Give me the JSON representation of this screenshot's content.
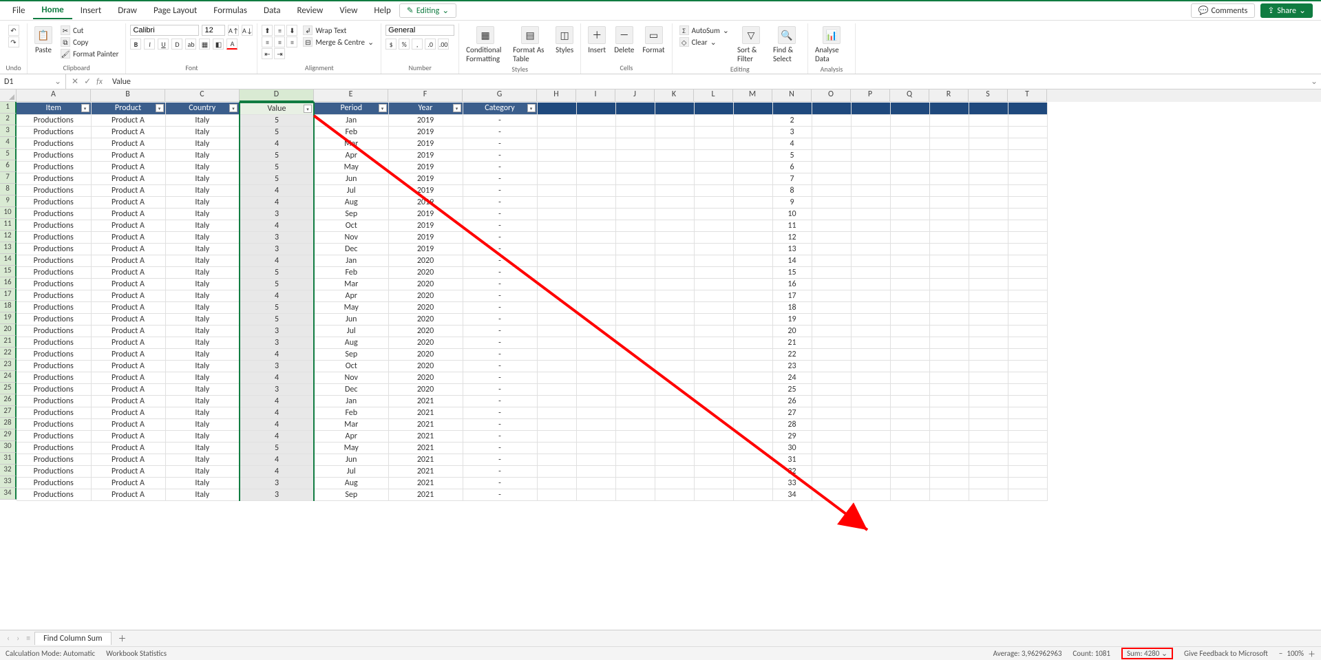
{
  "tabs": {
    "file": "File",
    "home": "Home",
    "insert": "Insert",
    "draw": "Draw",
    "layout": "Page Layout",
    "formulas": "Formulas",
    "data": "Data",
    "review": "Review",
    "view": "View",
    "help": "Help",
    "editing": "Editing",
    "comments": "Comments",
    "share": "Share"
  },
  "ribbon": {
    "undo": "Undo",
    "paste": "Paste",
    "cut": "Cut",
    "copy": "Copy",
    "painter": "Format Painter",
    "clipboard": "Clipboard",
    "font": "Font",
    "font_name": "Calibri",
    "font_size": "12",
    "alignment": "Alignment",
    "wrap": "Wrap Text",
    "merge": "Merge & Centre",
    "number": "Number",
    "number_format": "General",
    "styles": "Styles",
    "cond_fmt": "Conditional Formatting",
    "fmt_table": "Format As Table",
    "cell_styles": "Styles",
    "cells": "Cells",
    "insert_c": "Insert",
    "delete_c": "Delete",
    "format_c": "Format",
    "editing_g": "Editing",
    "autosum": "AutoSum",
    "clear": "Clear",
    "sort_filter": "Sort & Filter",
    "find_select": "Find & Select",
    "analysis": "Analysis",
    "analyse": "Analyse Data"
  },
  "formula": {
    "cell": "D1",
    "value": "Value"
  },
  "cols": [
    "A",
    "B",
    "C",
    "D",
    "E",
    "F",
    "G",
    "H",
    "I",
    "J",
    "K",
    "L",
    "M",
    "N",
    "O",
    "P",
    "Q",
    "R",
    "S",
    "T"
  ],
  "headers": [
    "Item",
    "Product",
    "Country",
    "Value",
    "Period",
    "Year",
    "Category"
  ],
  "rows": [
    {
      "n": 1
    },
    {
      "n": 2,
      "a": "Productions",
      "b": "Product A",
      "c": "Italy",
      "d": "5",
      "e": "Jan",
      "f": "2019",
      "g": "-"
    },
    {
      "n": 3,
      "a": "Productions",
      "b": "Product A",
      "c": "Italy",
      "d": "5",
      "e": "Feb",
      "f": "2019",
      "g": "-"
    },
    {
      "n": 4,
      "a": "Productions",
      "b": "Product A",
      "c": "Italy",
      "d": "4",
      "e": "Mar",
      "f": "2019",
      "g": "-"
    },
    {
      "n": 5,
      "a": "Productions",
      "b": "Product A",
      "c": "Italy",
      "d": "5",
      "e": "Apr",
      "f": "2019",
      "g": "-"
    },
    {
      "n": 6,
      "a": "Productions",
      "b": "Product A",
      "c": "Italy",
      "d": "5",
      "e": "May",
      "f": "2019",
      "g": "-"
    },
    {
      "n": 7,
      "a": "Productions",
      "b": "Product A",
      "c": "Italy",
      "d": "5",
      "e": "Jun",
      "f": "2019",
      "g": "-"
    },
    {
      "n": 8,
      "a": "Productions",
      "b": "Product A",
      "c": "Italy",
      "d": "4",
      "e": "Jul",
      "f": "2019",
      "g": "-"
    },
    {
      "n": 9,
      "a": "Productions",
      "b": "Product A",
      "c": "Italy",
      "d": "4",
      "e": "Aug",
      "f": "2019",
      "g": "-"
    },
    {
      "n": 10,
      "a": "Productions",
      "b": "Product A",
      "c": "Italy",
      "d": "3",
      "e": "Sep",
      "f": "2019",
      "g": "-"
    },
    {
      "n": 11,
      "a": "Productions",
      "b": "Product A",
      "c": "Italy",
      "d": "4",
      "e": "Oct",
      "f": "2019",
      "g": "-"
    },
    {
      "n": 12,
      "a": "Productions",
      "b": "Product A",
      "c": "Italy",
      "d": "3",
      "e": "Nov",
      "f": "2019",
      "g": "-"
    },
    {
      "n": 13,
      "a": "Productions",
      "b": "Product A",
      "c": "Italy",
      "d": "3",
      "e": "Dec",
      "f": "2019",
      "g": "-"
    },
    {
      "n": 14,
      "a": "Productions",
      "b": "Product A",
      "c": "Italy",
      "d": "4",
      "e": "Jan",
      "f": "2020",
      "g": "-"
    },
    {
      "n": 15,
      "a": "Productions",
      "b": "Product A",
      "c": "Italy",
      "d": "5",
      "e": "Feb",
      "f": "2020",
      "g": "-"
    },
    {
      "n": 16,
      "a": "Productions",
      "b": "Product A",
      "c": "Italy",
      "d": "5",
      "e": "Mar",
      "f": "2020",
      "g": "-"
    },
    {
      "n": 17,
      "a": "Productions",
      "b": "Product A",
      "c": "Italy",
      "d": "4",
      "e": "Apr",
      "f": "2020",
      "g": "-"
    },
    {
      "n": 18,
      "a": "Productions",
      "b": "Product A",
      "c": "Italy",
      "d": "5",
      "e": "May",
      "f": "2020",
      "g": "-"
    },
    {
      "n": 19,
      "a": "Productions",
      "b": "Product A",
      "c": "Italy",
      "d": "5",
      "e": "Jun",
      "f": "2020",
      "g": "-"
    },
    {
      "n": 20,
      "a": "Productions",
      "b": "Product A",
      "c": "Italy",
      "d": "3",
      "e": "Jul",
      "f": "2020",
      "g": "-"
    },
    {
      "n": 21,
      "a": "Productions",
      "b": "Product A",
      "c": "Italy",
      "d": "3",
      "e": "Aug",
      "f": "2020",
      "g": "-"
    },
    {
      "n": 22,
      "a": "Productions",
      "b": "Product A",
      "c": "Italy",
      "d": "4",
      "e": "Sep",
      "f": "2020",
      "g": "-"
    },
    {
      "n": 23,
      "a": "Productions",
      "b": "Product A",
      "c": "Italy",
      "d": "3",
      "e": "Oct",
      "f": "2020",
      "g": "-"
    },
    {
      "n": 24,
      "a": "Productions",
      "b": "Product A",
      "c": "Italy",
      "d": "4",
      "e": "Nov",
      "f": "2020",
      "g": "-"
    },
    {
      "n": 25,
      "a": "Productions",
      "b": "Product A",
      "c": "Italy",
      "d": "3",
      "e": "Dec",
      "f": "2020",
      "g": "-"
    },
    {
      "n": 26,
      "a": "Productions",
      "b": "Product A",
      "c": "Italy",
      "d": "4",
      "e": "Jan",
      "f": "2021",
      "g": "-"
    },
    {
      "n": 27,
      "a": "Productions",
      "b": "Product A",
      "c": "Italy",
      "d": "4",
      "e": "Feb",
      "f": "2021",
      "g": "-"
    },
    {
      "n": 28,
      "a": "Productions",
      "b": "Product A",
      "c": "Italy",
      "d": "4",
      "e": "Mar",
      "f": "2021",
      "g": "-"
    },
    {
      "n": 29,
      "a": "Productions",
      "b": "Product A",
      "c": "Italy",
      "d": "4",
      "e": "Apr",
      "f": "2021",
      "g": "-"
    },
    {
      "n": 30,
      "a": "Productions",
      "b": "Product A",
      "c": "Italy",
      "d": "5",
      "e": "May",
      "f": "2021",
      "g": "-"
    },
    {
      "n": 31,
      "a": "Productions",
      "b": "Product A",
      "c": "Italy",
      "d": "4",
      "e": "Jun",
      "f": "2021",
      "g": "-"
    },
    {
      "n": 32,
      "a": "Productions",
      "b": "Product A",
      "c": "Italy",
      "d": "4",
      "e": "Jul",
      "f": "2021",
      "g": "-"
    },
    {
      "n": 33,
      "a": "Productions",
      "b": "Product A",
      "c": "Italy",
      "d": "3",
      "e": "Aug",
      "f": "2021",
      "g": "-"
    },
    {
      "n": 34,
      "a": "Productions",
      "b": "Product A",
      "c": "Italy",
      "d": "3",
      "e": "Sep",
      "f": "2021",
      "g": "-"
    }
  ],
  "sheet": {
    "name": "Find Column Sum"
  },
  "status": {
    "calc": "Calculation Mode: Automatic",
    "wbstats": "Workbook Statistics",
    "avg": "Average: 3,962962963",
    "count": "Count: 1081",
    "sum": "Sum: 4280",
    "feedback": "Give Feedback to Microsoft",
    "zoom": "100%"
  }
}
